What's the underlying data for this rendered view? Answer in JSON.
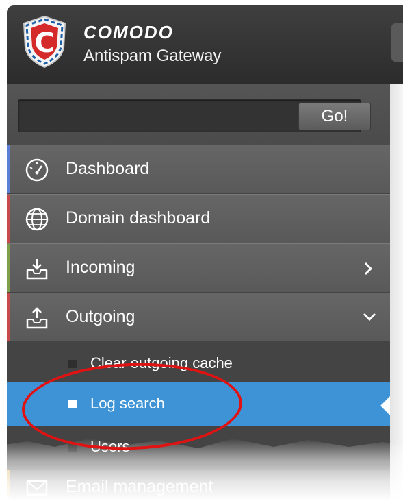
{
  "header": {
    "brand": "COMODO",
    "product": "Antispam Gateway"
  },
  "search": {
    "placeholder": "",
    "go_label": "Go!"
  },
  "menu": {
    "items": [
      {
        "label": "Dashboard",
        "icon": "dashboard-gauge-icon",
        "accent": "#5b7fd6"
      },
      {
        "label": "Domain dashboard",
        "icon": "globe-icon",
        "accent": "#c84a4a"
      },
      {
        "label": "Incoming",
        "icon": "inbox-download-icon",
        "accent": "#7fa04a",
        "arrow": "chevron-right-icon"
      },
      {
        "label": "Outgoing",
        "icon": "outbox-upload-icon",
        "accent": "#c84a4a",
        "arrow": "chevron-down-icon"
      }
    ],
    "outgoing_submenu": [
      {
        "label": "Clear outgoing cache"
      },
      {
        "label": "Log search",
        "selected": true
      },
      {
        "label": "Users"
      }
    ],
    "partial_item": {
      "label": "Email management",
      "icon": "envelope-icon"
    }
  },
  "colors": {
    "header_bg": "#333333",
    "selected_bg": "#3d93d6",
    "highlight_ellipse": "#e01212"
  }
}
